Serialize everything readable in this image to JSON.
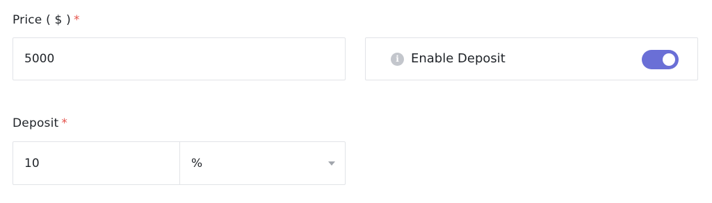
{
  "price": {
    "label": "Price ( $ )",
    "required_mark": "*",
    "value": "5000"
  },
  "deposit_toggle": {
    "label": "Enable Deposit",
    "info_icon": "i",
    "enabled": true,
    "accent_color": "#6a6fd6"
  },
  "deposit": {
    "label": "Deposit",
    "required_mark": "*",
    "value": "10",
    "unit_selected": "%"
  },
  "colors": {
    "required": "#e5534b",
    "border": "#e1e3e7"
  }
}
